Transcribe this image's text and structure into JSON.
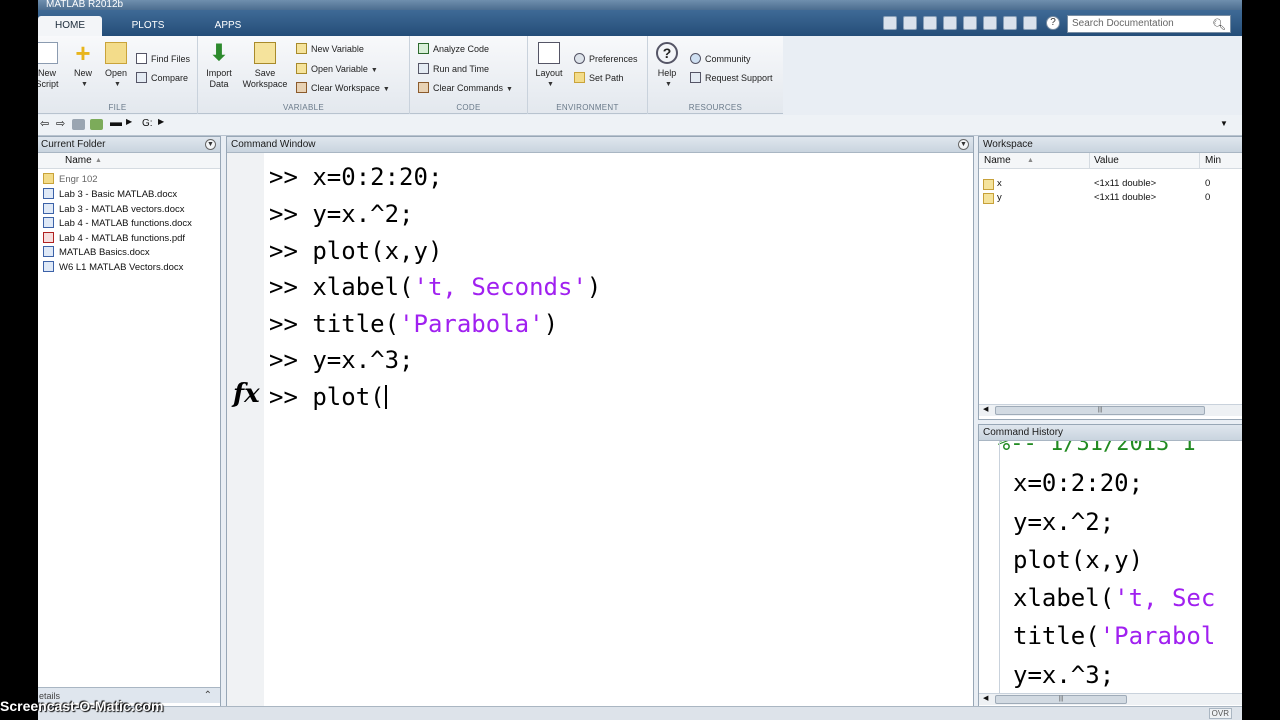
{
  "window": {
    "title": "MATLAB R2012b"
  },
  "tabs": [
    "HOME",
    "PLOTS",
    "APPS"
  ],
  "search": {
    "placeholder": "Search Documentation"
  },
  "ribbon": {
    "file": {
      "label": "FILE",
      "new_script": "New\nScript",
      "new": "New",
      "open": "Open",
      "find_files": "Find Files",
      "compare": "Compare"
    },
    "variable": {
      "label": "VARIABLE",
      "import_data": "Import\nData",
      "save_workspace": "Save\nWorkspace",
      "new_variable": "New Variable",
      "open_variable": "Open Variable",
      "clear_workspace": "Clear Workspace"
    },
    "code": {
      "label": "CODE",
      "analyze_code": "Analyze Code",
      "run_and_time": "Run and Time",
      "clear_commands": "Clear Commands"
    },
    "environment": {
      "label": "ENVIRONMENT",
      "layout": "Layout",
      "preferences": "Preferences",
      "set_path": "Set Path"
    },
    "resources": {
      "label": "RESOURCES",
      "help": "Help",
      "community": "Community",
      "request_support": "Request Support"
    }
  },
  "address": {
    "path": "G:"
  },
  "current_folder": {
    "title": "Current Folder",
    "col_name": "Name",
    "items": [
      {
        "name": "Engr 102",
        "type": "folder"
      },
      {
        "name": "Lab 3 - Basic MATLAB.docx",
        "type": "docx"
      },
      {
        "name": "Lab 3 - MATLAB vectors.docx",
        "type": "docx"
      },
      {
        "name": "Lab 4 - MATLAB functions.docx",
        "type": "docx"
      },
      {
        "name": "Lab 4 - MATLAB functions.pdf",
        "type": "pdf"
      },
      {
        "name": "MATLAB Basics.docx",
        "type": "docx"
      },
      {
        "name": "W6 L1 MATLAB Vectors.docx",
        "type": "docx"
      }
    ],
    "details": "etails"
  },
  "command_window": {
    "title": "Command Window",
    "prompt": ">>",
    "fx": "fx",
    "lines": [
      {
        "code": "x=0:2:20;",
        "pre": "",
        "str": "",
        "post": ""
      },
      {
        "code": "y=x.^2;",
        "pre": "",
        "str": "",
        "post": ""
      },
      {
        "code": "plot(x,y)",
        "pre": "",
        "str": "",
        "post": ""
      },
      {
        "code": "",
        "pre": "xlabel(",
        "str": "'t, Seconds'",
        "post": ")"
      },
      {
        "code": "",
        "pre": "title(",
        "str": "'Parabola'",
        "post": ")"
      },
      {
        "code": "y=x.^3;",
        "pre": "",
        "str": "",
        "post": ""
      },
      {
        "code": "plot(",
        "pre": "",
        "str": "",
        "post": ""
      }
    ]
  },
  "workspace": {
    "title": "Workspace",
    "columns": [
      "Name",
      "Value",
      "Min"
    ],
    "rows": [
      {
        "name": "x",
        "value": "<1x11 double>",
        "min": "0"
      },
      {
        "name": "y",
        "value": "<1x11 double>",
        "min": "0"
      }
    ]
  },
  "command_history": {
    "title": "Command History",
    "header": "%-- 1/31/2013 1",
    "lines": [
      {
        "pre": "x=0:2:20;",
        "str": ""
      },
      {
        "pre": "y=x.^2;",
        "str": ""
      },
      {
        "pre": "plot(x,y)",
        "str": ""
      },
      {
        "pre": "xlabel(",
        "str": "'t, Sec"
      },
      {
        "pre": "title(",
        "str": "'Parabol"
      },
      {
        "pre": "y=x.^3;",
        "str": ""
      }
    ]
  },
  "status": {
    "mode": "OVR"
  },
  "watermark": "Screencast-O-Matic.com",
  "colors": {
    "string": "#a020f0",
    "tabstrip": "#244d78"
  }
}
